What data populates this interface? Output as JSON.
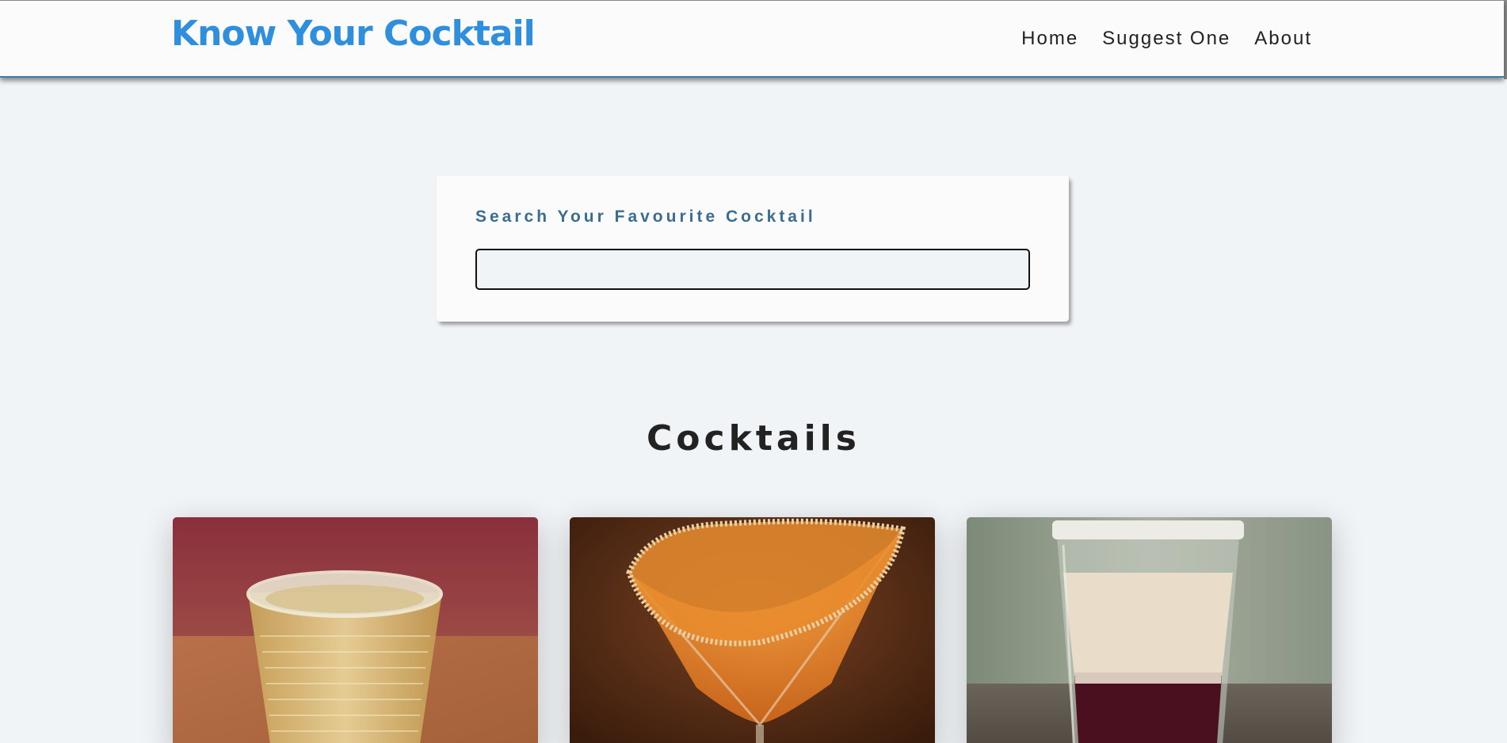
{
  "navbar": {
    "brand": "Know Your Cocktail",
    "links": [
      {
        "label": "Home"
      },
      {
        "label": "Suggest One"
      },
      {
        "label": "About"
      }
    ]
  },
  "search": {
    "label": "Search Your Favourite Cocktail",
    "value": "",
    "placeholder": ""
  },
  "section": {
    "title": "Cocktails"
  },
  "cocktails": [
    {
      "image": "cocktail-photo-whiskey-glass"
    },
    {
      "image": "cocktail-photo-orange-martini"
    },
    {
      "image": "cocktail-photo-layered-shot"
    }
  ],
  "colors": {
    "brand": "#2f8fdc",
    "search_label": "#3a6d91",
    "page_bg": "#f1f4f7",
    "nav_border": "#3e7fa8"
  }
}
